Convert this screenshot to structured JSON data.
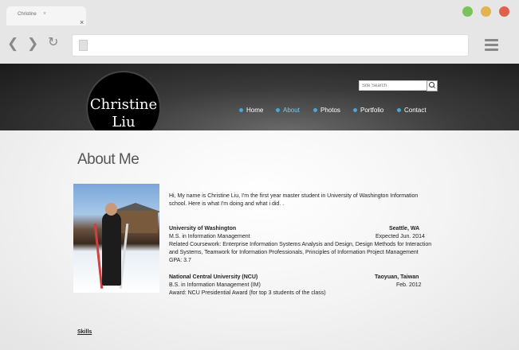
{
  "browser": {
    "tab_title": "Christine",
    "tab_close": "×",
    "tab_dot": "×"
  },
  "site": {
    "logo_line1": "Christine",
    "logo_line2": "Liu",
    "search_placeholder": "Site Search",
    "menu": [
      "Home",
      "About",
      "Photos",
      "Portfolio",
      "Contact"
    ],
    "active_menu": "About",
    "accent_color": "#4aa7d8"
  },
  "content": {
    "page_title": "About Me",
    "intro_line1": "Hi, My name is Christine Liu, I'm the first year master student in University of Washington Information",
    "intro_line2": "school. Here is what I'm doing and what i did. .",
    "edu1": {
      "school": "University of Washington",
      "location": "Seattle, WA",
      "degree": "M.S. in Information Management",
      "date": "Expected Jun. 2014",
      "course_line1": "Related Coursework: Enterprise Information Systems Analysis and Design, Design Methods for Interaction",
      "course_line2": "and Systems, Teamwork for Information Professionals, Principles of Information Project Management",
      "gpa": "GPA: 3.7"
    },
    "edu2": {
      "school": "National Central University (NCU)",
      "location": "Taoyuan, Taiwan",
      "degree": "B.S. in Information Management (IM)",
      "date": "Feb. 2012",
      "award": "Award: NCU Presidential Award (for top 3 students of the class)"
    },
    "skills_heading": "Skills"
  }
}
